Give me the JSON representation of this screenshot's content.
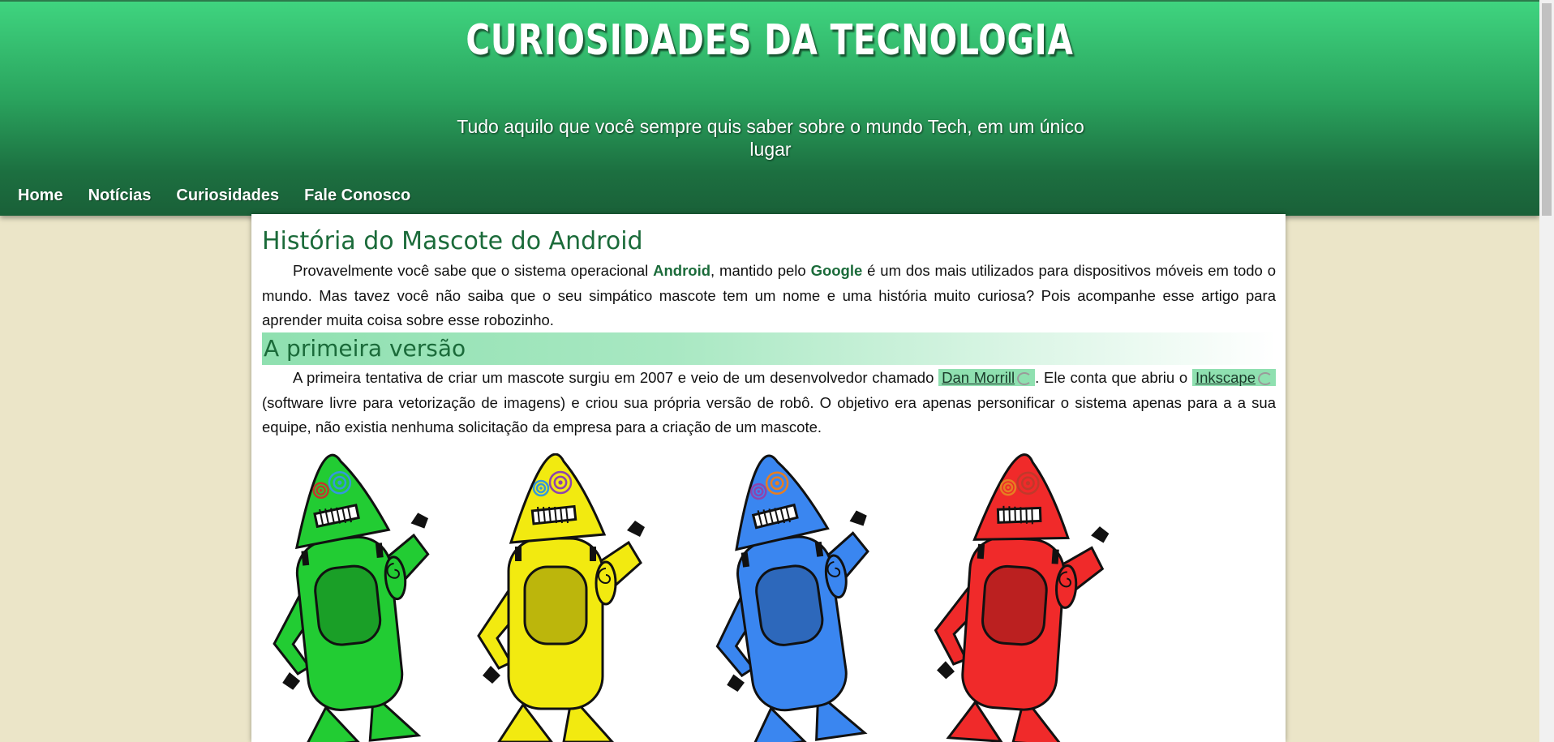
{
  "header": {
    "title": "CURIOSIDADES DA TECNOLOGIA",
    "tagline": "Tudo aquilo que você sempre quis saber sobre o mundo Tech, em um único lugar"
  },
  "nav": [
    {
      "label": "Home"
    },
    {
      "label": "Notícias"
    },
    {
      "label": "Curiosidades"
    },
    {
      "label": "Fale Conosco"
    }
  ],
  "article": {
    "title": "História do Mascote do Android",
    "p1": {
      "t1": "Provavelmente você sabe que o sistema operacional ",
      "android": "Android",
      "t2": ", mantido pelo ",
      "google": "Google",
      "t3": " é um dos mais utilizados para dispositivos móveis em todo o mundo. Mas tavez você não saiba que o seu simpático mascote tem um nome e uma história muito curiosa? Pois acompanhe esse artigo para aprender muita coisa sobre esse robozinho."
    },
    "section_title": "A primeira versão",
    "p2": {
      "t1": "A primeira tentativa de criar um mascote surgiu em 2007 e veio de um desenvolvedor chamado ",
      "link1": "Dan Morrill",
      "t2": ". Ele conta que abriu o ",
      "link2": "Inkscape",
      "t3": " (software livre para vetorização de imagens) e criou sua própria versão de robô. O objetivo era apenas personificar o sistema apenas para a a sua equipe, não existia nenhuma solicitação da empresa para a criação de um mascote."
    },
    "robot_colors": [
      "#22cc33",
      "#f2ea10",
      "#3a86f0",
      "#f02a2a"
    ]
  },
  "colors": {
    "accent_green": "#1b6b3a",
    "highlight": "#8fe0b0",
    "page_background": "#ebe5c8"
  }
}
